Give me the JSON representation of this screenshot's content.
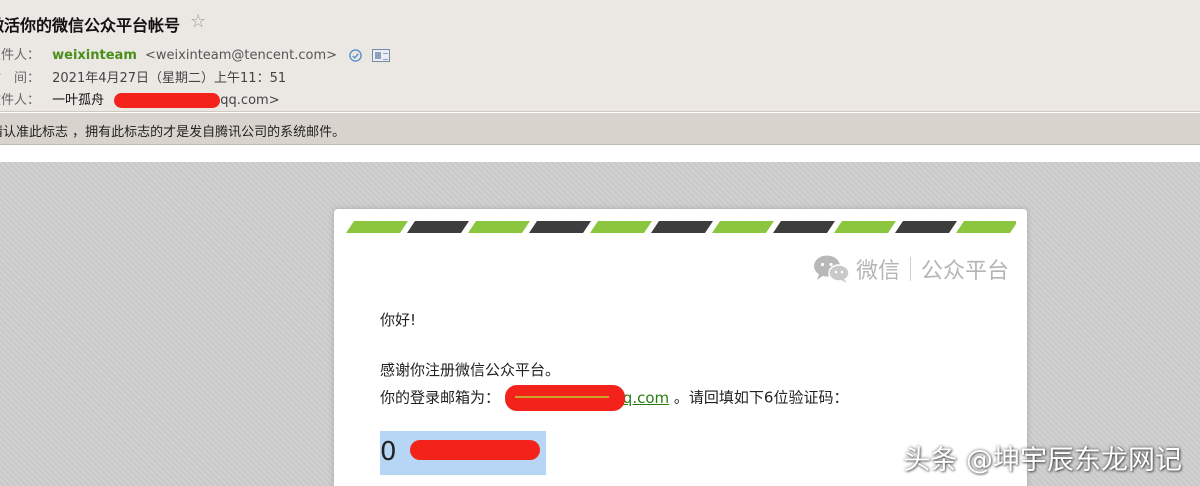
{
  "header": {
    "subject": "激活你的微信公众平台帐号",
    "star_icon": "star-outline-icon",
    "from_label": "发件人：",
    "sender_name": "weixinteam",
    "sender_email": "<weixinteam@tencent.com>",
    "time_label": "时　间：",
    "time_value": "2021年4月27日（星期二）上午11：51",
    "to_label": "收件人：",
    "recipient_name": "一叶孤舟",
    "recipient_email_suffix": "qq.com>",
    "notice": "请认准此标志  ，拥有此标志的才是发自腾讯公司的系统邮件。"
  },
  "email": {
    "brand_left": "微信",
    "brand_right": "公众平台",
    "greeting": "你好!",
    "thanks": "感谢你注册微信公众平台。",
    "login_prefix": "你的登录邮箱为：",
    "login_email_suffix": "q.com",
    "login_suffix": "。请回填如下6位验证码：",
    "code_first_digit": "0"
  },
  "watermark": "头条 @坤宇辰东龙网记",
  "colors": {
    "accent_green": "#4a8f1a",
    "stripe_green": "#8cc63f",
    "stripe_dark": "#3d3d3d",
    "redact_red": "#f3231b"
  }
}
